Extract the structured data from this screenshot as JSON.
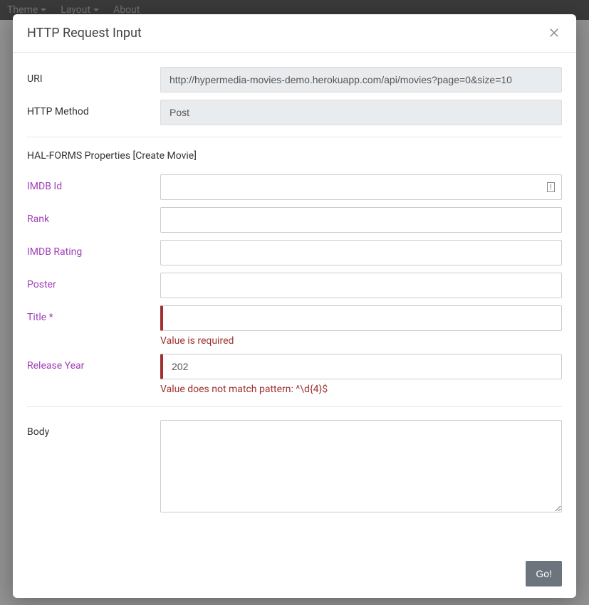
{
  "navbar": {
    "theme": "Theme",
    "layout": "Layout",
    "about": "About"
  },
  "modal": {
    "title": "HTTP Request Input",
    "go_label": "Go!"
  },
  "fields": {
    "uri": {
      "label": "URI",
      "value": "http://hypermedia-movies-demo.herokuapp.com/api/movies?page=0&size=10"
    },
    "method": {
      "label": "HTTP Method",
      "value": "Post"
    },
    "section_heading": "HAL-FORMS Properties [Create Movie]",
    "imdb_id": {
      "label": "IMDB Id",
      "value": ""
    },
    "rank": {
      "label": "Rank",
      "value": ""
    },
    "imdb_rating": {
      "label": "IMDB Rating",
      "value": ""
    },
    "poster": {
      "label": "Poster",
      "value": ""
    },
    "title": {
      "label": "Title *",
      "value": "",
      "error": "Value is required"
    },
    "release_year": {
      "label": "Release Year",
      "value": "202",
      "error": "Value does not match pattern: ^\\d{4}$"
    },
    "body": {
      "label": "Body",
      "value": ""
    }
  }
}
